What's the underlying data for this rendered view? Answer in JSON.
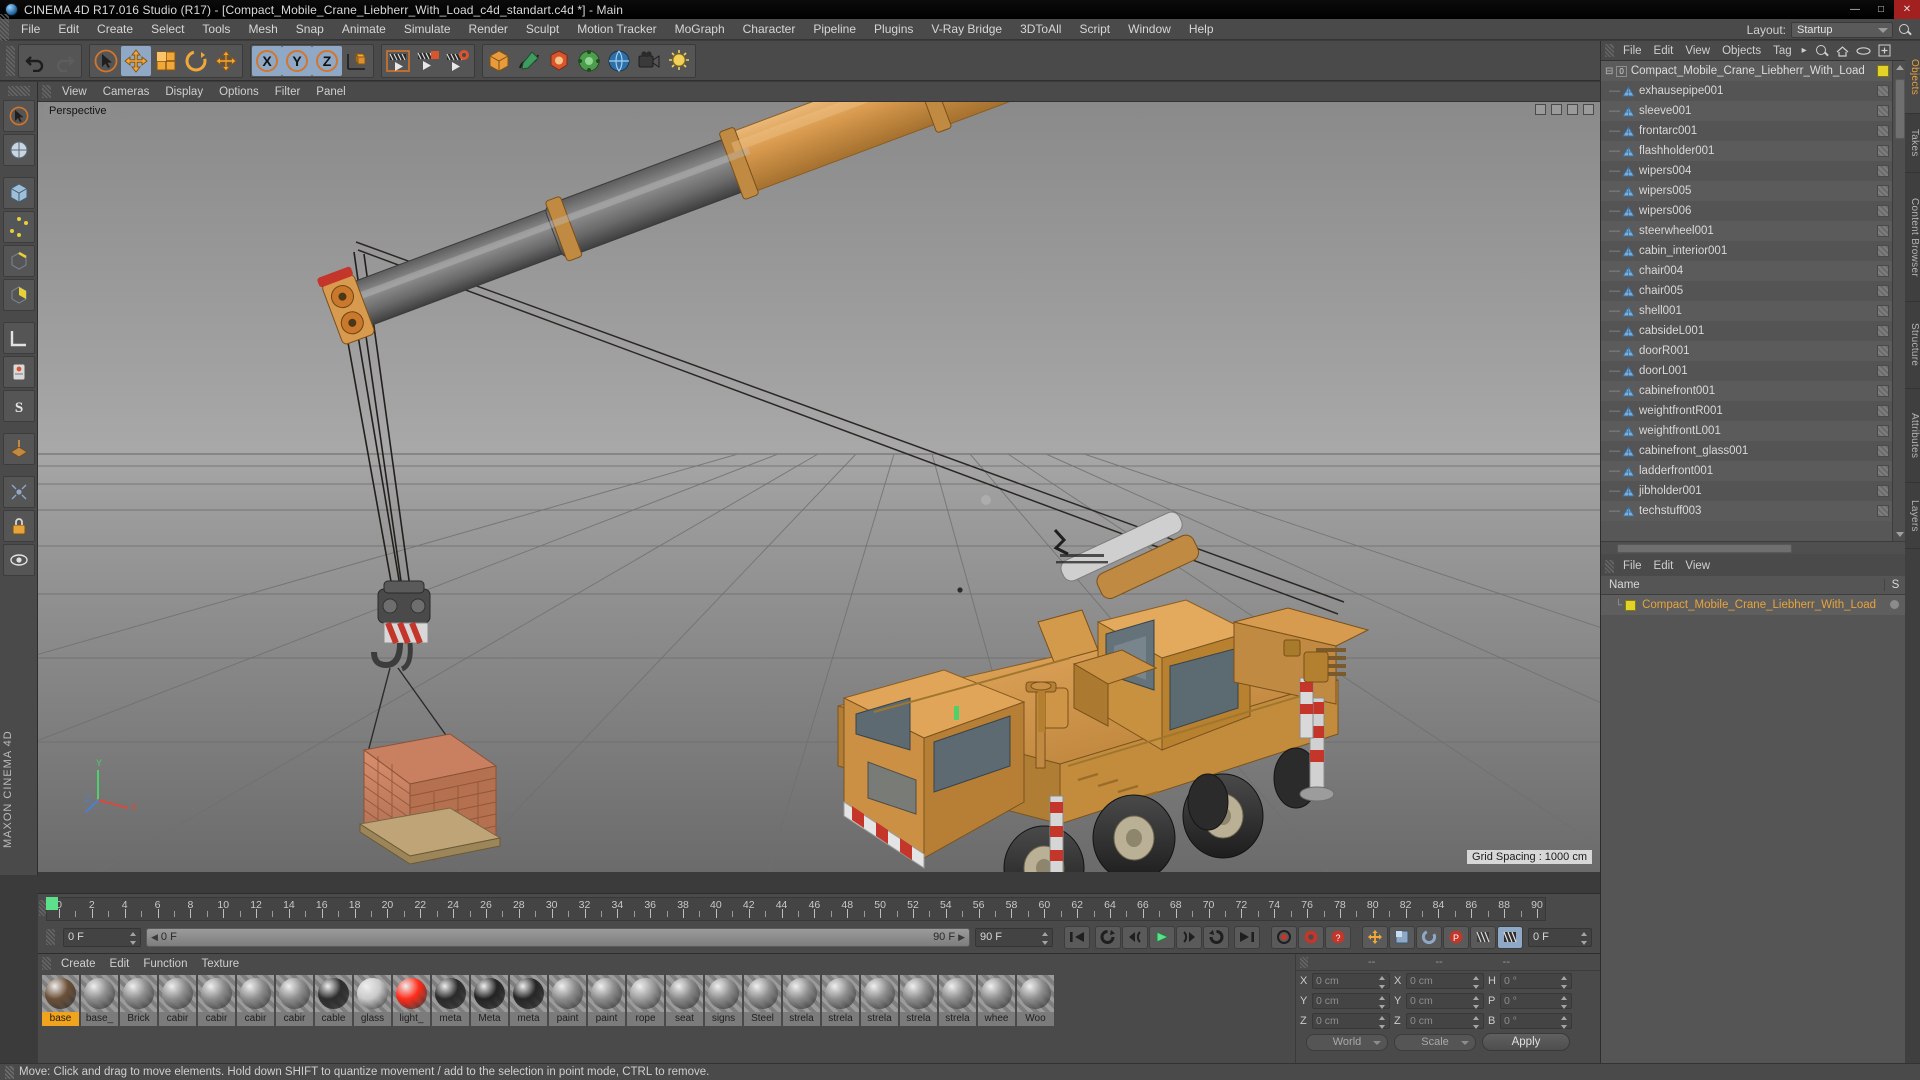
{
  "window": {
    "title": "CINEMA 4D R17.016 Studio (R17) - [Compact_Mobile_Crane_Liebherr_With_Load_c4d_standart.c4d *] - Main",
    "minimize": "—",
    "maximize": "□",
    "close": "✕"
  },
  "menubar": {
    "items": [
      "File",
      "Edit",
      "Create",
      "Select",
      "Tools",
      "Mesh",
      "Snap",
      "Animate",
      "Simulate",
      "Render",
      "Sculpt",
      "Motion Tracker",
      "MoGraph",
      "Character",
      "Pipeline",
      "Plugins",
      "V-Ray Bridge",
      "3DToAll",
      "Script",
      "Window",
      "Help"
    ],
    "layout_label": "Layout:",
    "layout_value": "Startup",
    "search_icon": "search-icon"
  },
  "toolbar": {
    "groups": [
      {
        "name": "history",
        "buttons": [
          {
            "icon": "undo-icon",
            "active": false
          },
          {
            "icon": "redo-icon",
            "active": false
          }
        ]
      },
      {
        "name": "transform",
        "buttons": [
          {
            "icon": "select-live-icon",
            "active": false
          },
          {
            "icon": "move-icon",
            "active": true
          },
          {
            "icon": "scale-icon",
            "active": false
          },
          {
            "icon": "rotate-icon",
            "active": false
          },
          {
            "icon": "move-alt-icon",
            "active": false
          }
        ]
      },
      {
        "name": "axis-locks",
        "buttons": [
          {
            "icon": "axis-x-icon",
            "active": true
          },
          {
            "icon": "axis-y-icon",
            "active": true
          },
          {
            "icon": "axis-z-icon",
            "active": true
          },
          {
            "icon": "world-axis-icon",
            "active": false
          }
        ]
      },
      {
        "name": "render",
        "buttons": [
          {
            "icon": "render-view-icon",
            "active": false
          },
          {
            "icon": "render-region-icon",
            "active": false
          },
          {
            "icon": "render-settings-icon",
            "active": false
          }
        ]
      },
      {
        "name": "primitives",
        "buttons": [
          {
            "icon": "cube-icon",
            "active": false
          },
          {
            "icon": "spline-pen-icon",
            "active": false
          },
          {
            "icon": "generator-icon",
            "active": false
          },
          {
            "icon": "deformer-icon",
            "active": false
          },
          {
            "icon": "environment-icon",
            "active": false
          },
          {
            "icon": "camera-icon",
            "active": false
          },
          {
            "icon": "light-icon",
            "active": false
          }
        ]
      }
    ]
  },
  "leftbar": {
    "buttons": [
      "live-selection-icon",
      "uv-tool-icon",
      "cube-mode-icon",
      "point-mode-icon",
      "edge-mode-icon",
      "polygon-mode-icon",
      "model-mode-icon",
      "texture-axis-icon",
      "axis-lock-icon",
      "snap-icon",
      "workplane-icon",
      "enable-axis-icon",
      "viewport-solo-icon",
      "lock-icon",
      "visibility-icon"
    ],
    "brand": "MAXON CINEMA 4D"
  },
  "viewport": {
    "menu": [
      "View",
      "Cameras",
      "Display",
      "Options",
      "Filter",
      "Panel"
    ],
    "label": "Perspective",
    "grid_spacing": "Grid Spacing : 1000 cm",
    "axis_labels": {
      "x": "X",
      "y": "Y",
      "z": "Z"
    },
    "scene_description": "Orange Liebherr compact mobile crane with extended telescopic boom, hook block and suspended brick pallet load on a grey ground grid"
  },
  "object_manager": {
    "menu": [
      "File",
      "Edit",
      "View",
      "Objects",
      "Tag"
    ],
    "menu_overflow": "▸",
    "icons": [
      "search-icon",
      "home-icon",
      "ellipse-icon",
      "add-layer-icon"
    ],
    "root": {
      "label": "Compact_Mobile_Crane_Liebherr_With_Load",
      "level": "0"
    },
    "items": [
      "exhausepipe001",
      "sleeve001",
      "frontarc001",
      "flashholder001",
      "wipers004",
      "wipers005",
      "wipers006",
      "steerwheel001",
      "cabin_interior001",
      "chair004",
      "chair005",
      "shell001",
      "cabsideL001",
      "doorR001",
      "doorL001",
      "cabinefront001",
      "weightfrontR001",
      "weightfrontL001",
      "cabinefront_glass001",
      "ladderfront001",
      "jibholder001",
      "techstuff003"
    ]
  },
  "attribute_manager": {
    "menu": [
      "File",
      "Edit",
      "View"
    ],
    "columns": {
      "name": "Name",
      "short": "S"
    },
    "rows": [
      {
        "label": "Compact_Mobile_Crane_Liebherr_With_Load"
      }
    ]
  },
  "right_tabs": [
    {
      "label": "Objects",
      "selected": true
    },
    {
      "label": "Takes",
      "selected": false
    },
    {
      "label": "Content Browser",
      "selected": false
    },
    {
      "label": "Structure",
      "selected": false
    },
    {
      "label": "Attributes",
      "selected": false
    },
    {
      "label": "Layers",
      "selected": false
    }
  ],
  "timeline": {
    "ticks": [
      0,
      2,
      4,
      6,
      8,
      10,
      12,
      14,
      16,
      18,
      20,
      22,
      24,
      26,
      28,
      30,
      32,
      34,
      36,
      38,
      40,
      42,
      44,
      46,
      48,
      50,
      52,
      54,
      56,
      58,
      60,
      62,
      64,
      66,
      68,
      70,
      72,
      74,
      76,
      78,
      80,
      82,
      84,
      86,
      88,
      90
    ],
    "current_frame_field": "0 F",
    "current_frame_end_field": "0 F",
    "range_start": "0 F",
    "range_end": "90 F",
    "end_field": "90 F",
    "right_field": "0 F",
    "transport": [
      "go-to-start-icon",
      "play-backward-loop-icon",
      "step-back-icon",
      "play-icon",
      "step-forward-icon",
      "play-forward-loop-icon",
      "go-to-end-icon",
      "record-loop-icon"
    ],
    "record_buttons": [
      "record-keyframe-icon",
      "autokey-icon",
      "keyframe-selection-icon"
    ],
    "key_buttons": [
      "position-key-icon",
      "scale-key-icon",
      "rotation-key-icon",
      "parameter-key-icon",
      "point-level-key-icon",
      "animation-mode-icon"
    ]
  },
  "material_manager": {
    "menu": [
      "Create",
      "Edit",
      "Function",
      "Texture"
    ],
    "materials": [
      {
        "name": "base",
        "selected": true,
        "color": "#6b4f36"
      },
      {
        "name": "base_",
        "selected": false,
        "color": "#8e8e8e"
      },
      {
        "name": "Brick",
        "selected": false,
        "color": "#8e8e8e"
      },
      {
        "name": "cabir",
        "selected": false,
        "color": "#8e8e8e"
      },
      {
        "name": "cabir",
        "selected": false,
        "color": "#8e8e8e"
      },
      {
        "name": "cabir",
        "selected": false,
        "color": "#8e8e8e"
      },
      {
        "name": "cabir",
        "selected": false,
        "color": "#8e8e8e"
      },
      {
        "name": "cable",
        "selected": false,
        "color": "#2d2d2d"
      },
      {
        "name": "glass",
        "selected": false,
        "color": "#c9c9c9"
      },
      {
        "name": "light_",
        "selected": false,
        "color": "#ff2b1a"
      },
      {
        "name": "meta",
        "selected": false,
        "color": "#2a2a2a"
      },
      {
        "name": "Meta",
        "selected": false,
        "color": "#232323"
      },
      {
        "name": "meta",
        "selected": false,
        "color": "#262626"
      },
      {
        "name": "paint",
        "selected": false,
        "color": "#8e8e8e"
      },
      {
        "name": "paint",
        "selected": false,
        "color": "#8e8e8e"
      },
      {
        "name": "rope",
        "selected": false,
        "color": "#9e9e9e"
      },
      {
        "name": "seat",
        "selected": false,
        "color": "#8a8a8a"
      },
      {
        "name": "signs",
        "selected": false,
        "color": "#8e8e8e"
      },
      {
        "name": "Steel",
        "selected": false,
        "color": "#8e8e8e"
      },
      {
        "name": "strela",
        "selected": false,
        "color": "#8e8e8e"
      },
      {
        "name": "strela",
        "selected": false,
        "color": "#8e8e8e"
      },
      {
        "name": "strela",
        "selected": false,
        "color": "#8e8e8e"
      },
      {
        "name": "strela",
        "selected": false,
        "color": "#8e8e8e"
      },
      {
        "name": "strela",
        "selected": false,
        "color": "#8e8e8e"
      },
      {
        "name": "whee",
        "selected": false,
        "color": "#8e8e8e"
      },
      {
        "name": "Woo",
        "selected": false,
        "color": "#8e8e8e"
      }
    ]
  },
  "coordinates": {
    "header": [
      "--",
      "--",
      "--"
    ],
    "rows": [
      {
        "l1": "X",
        "v1": "0 cm",
        "l2": "X",
        "v2": "0 cm",
        "l3": "H",
        "v3": "0 °"
      },
      {
        "l1": "Y",
        "v1": "0 cm",
        "l2": "Y",
        "v2": "0 cm",
        "l3": "P",
        "v3": "0 °"
      },
      {
        "l1": "Z",
        "v1": "0 cm",
        "l2": "Z",
        "v2": "0 cm",
        "l3": "B",
        "v3": "0 °"
      }
    ],
    "world_dropdown": "World",
    "scale_dropdown": "Scale",
    "apply_button": "Apply"
  },
  "statusbar": {
    "text": "Move: Click and drag to move elements. Hold down SHIFT to quantize movement / add to the selection in point mode, CTRL to remove."
  },
  "colors": {
    "chrome": "#4a4a4a",
    "panel": "#555555",
    "accent_orange": "#e8a33d",
    "highlight_blue": "#8fa8c6",
    "crane_body": "#d89a4e",
    "selected_material": "#f0a41e"
  }
}
